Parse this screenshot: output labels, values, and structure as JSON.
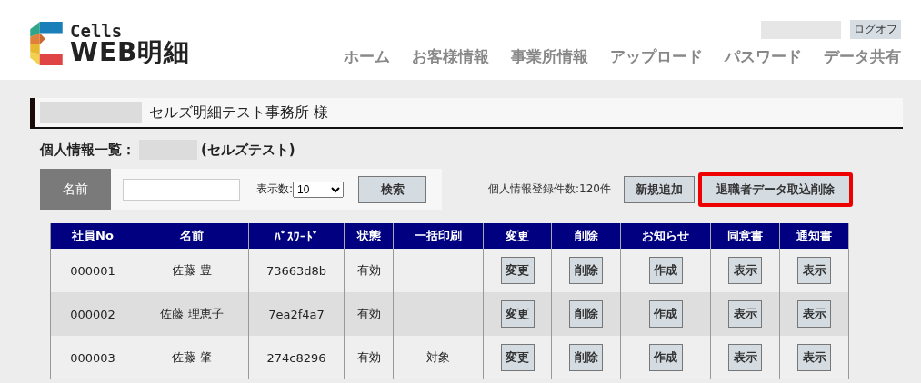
{
  "logo": {
    "line_1": "Cells",
    "line_2": "WEB明細"
  },
  "user": {
    "logoff": "ログオフ"
  },
  "nav": [
    "ホーム",
    "お客様情報",
    "事業所情報",
    "アップロード",
    "パスワード",
    "データ共有"
  ],
  "office": {
    "name": "セルズ明細テスト事務所 様"
  },
  "section": {
    "label": "個人情報一覧：",
    "company": "(セルズテスト)"
  },
  "search": {
    "name_label": "名前",
    "count_label": "表示数:",
    "count_value": "10",
    "button": "検索"
  },
  "summary": "個人情報登録件数:120件",
  "actions": [
    {
      "label": "新規追加",
      "highlighted": false
    },
    {
      "label": "退職者データ取込削除",
      "highlighted": true
    }
  ],
  "table": {
    "columns": [
      {
        "label": "社員No",
        "link": true
      },
      {
        "label": "名前",
        "link": false
      },
      {
        "label": "ﾊﾟｽﾜｰﾄﾞ",
        "link": false
      },
      {
        "label": "状態",
        "link": false
      },
      {
        "label": "一括印刷",
        "link": false
      },
      {
        "label": "変更",
        "link": false
      },
      {
        "label": "削除",
        "link": false
      },
      {
        "label": "お知らせ",
        "link": false
      },
      {
        "label": "同意書",
        "link": false
      },
      {
        "label": "通知書",
        "link": false
      }
    ],
    "rows": [
      {
        "cells": [
          "000001",
          "佐藤 豊",
          "73663d8b",
          "有効",
          ""
        ],
        "buttons": [
          "変更",
          "削除",
          "作成",
          "表示",
          "表示"
        ]
      },
      {
        "cells": [
          "000002",
          "佐藤 理恵子",
          "7ea2f4a7",
          "有効",
          ""
        ],
        "buttons": [
          "変更",
          "削除",
          "作成",
          "表示",
          "表示"
        ]
      },
      {
        "cells": [
          "000003",
          "佐藤 肇",
          "274c8296",
          "有効",
          "対象"
        ],
        "buttons": [
          "変更",
          "削除",
          "作成",
          "表示",
          "表示"
        ]
      }
    ]
  }
}
